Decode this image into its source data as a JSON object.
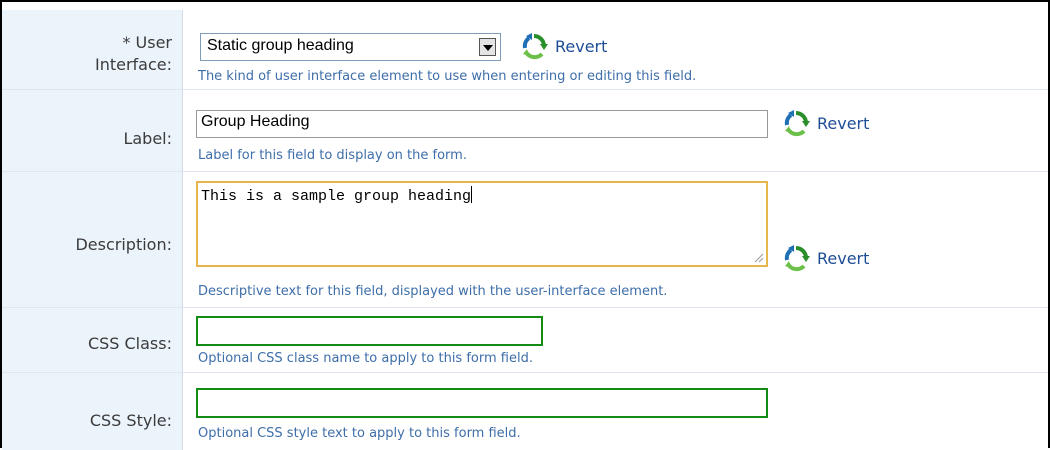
{
  "fields": [
    {
      "id": "user-interface",
      "label": "User Interface:",
      "required_marker": "*",
      "label_line1": "User",
      "label_line2": "Interface:",
      "value": "Static group heading",
      "help": "The kind of user interface element to use when entering or editing this field.",
      "revert_label": "Revert"
    },
    {
      "id": "label",
      "label": "Label:",
      "value": "Group Heading",
      "help": "Label for this field to display on the form.",
      "revert_label": "Revert"
    },
    {
      "id": "description",
      "label": "Description:",
      "value": "This is a sample group heading",
      "help": "Descriptive text for this field, displayed with the user-interface element.",
      "revert_label": "Revert"
    },
    {
      "id": "css-class",
      "label": "CSS Class:",
      "value": "",
      "help": "Optional CSS class name to apply to this form field."
    },
    {
      "id": "css-style",
      "label": "CSS Style:",
      "value": "",
      "help": "Optional CSS style text to apply to this form field."
    }
  ],
  "colors": {
    "label_background": "#ebf3fb",
    "help_text": "#3e6ea9",
    "revert_link": "#1e4d96",
    "focused_textarea_border": "#e6b54c",
    "valid_input_border": "#138a13"
  },
  "icons": {
    "revert": "revert-arrows-icon",
    "select_arrow": "chevron-down-icon",
    "resize": "resize-grip-icon"
  }
}
